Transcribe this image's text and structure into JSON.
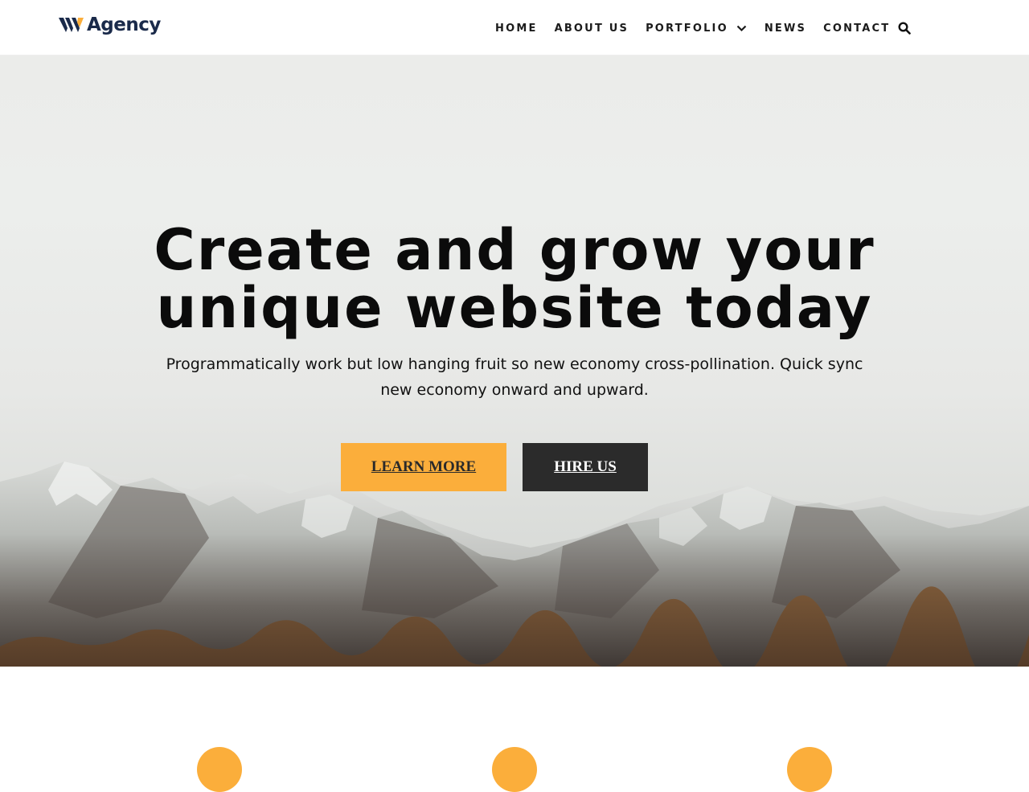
{
  "brand": {
    "name": "Agency",
    "logo_icon": "w-logo-icon",
    "logo_colors": {
      "primary": "#1a2a4a",
      "accent": "#fbae3b"
    }
  },
  "nav": {
    "items": [
      {
        "label": "HOME"
      },
      {
        "label": "ABOUT US"
      },
      {
        "label": "PORTFOLIO",
        "has_dropdown": true,
        "icon": "chevron-down-icon"
      },
      {
        "label": "NEWS"
      },
      {
        "label": "CONTACT"
      }
    ],
    "search_icon": "search-icon"
  },
  "hero": {
    "title": "Create and grow your unique website today",
    "subtitle": "Programmatically work but low hanging fruit so new economy cross-pollination. Quick sync new economy onward and upward.",
    "background": "mountain-landscape-image",
    "buttons": {
      "primary": {
        "label": "LEARN MORE",
        "color": "#fbae3b",
        "text_color": "#2a2a2a"
      },
      "secondary": {
        "label": "HIRE US",
        "color": "#2b2b2b",
        "text_color": "#ffffff"
      }
    }
  },
  "features": {
    "circle_color": "#fbae3b",
    "items": [
      {
        "icon": "feature-circle"
      },
      {
        "icon": "feature-circle"
      },
      {
        "icon": "feature-circle"
      }
    ]
  }
}
